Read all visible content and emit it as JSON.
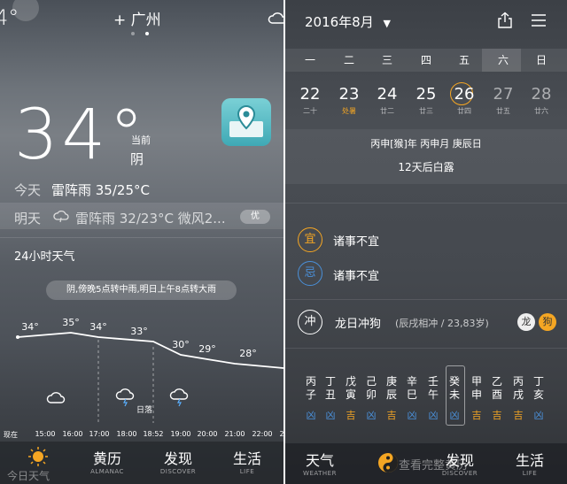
{
  "left": {
    "edge_temp": "4°",
    "city": "+ 广州",
    "current": {
      "temp": "34°",
      "label": "当前",
      "condition": "阴"
    },
    "today": {
      "label": "今天",
      "text": "雷阵雨 35/25°C"
    },
    "tomorrow": {
      "label": "明天",
      "text": "雷阵雨 32/23°C 微风2...",
      "badge": "优"
    },
    "hourly_title": "24小时天气",
    "notice": "阴,傍晚5点转中雨,明日上午8点转大雨",
    "hourly": {
      "temps": [
        "34°",
        "35°",
        "34°",
        "33°",
        "30°",
        "29°",
        "28°"
      ],
      "temp_values": [
        34,
        35,
        34,
        33,
        30,
        29,
        28
      ],
      "sunset_label": "日落",
      "times": [
        "现在",
        "15:00",
        "16:00",
        "17:00",
        "18:00",
        "18:52",
        "19:00",
        "20:00",
        "21:00",
        "22:00",
        "2"
      ]
    },
    "tabs": [
      {
        "label": "今日天气",
        "sub": ""
      },
      {
        "label": "黄历",
        "sub": "ALMANAC"
      },
      {
        "label": "发现",
        "sub": "DISCOVER"
      },
      {
        "label": "生活",
        "sub": "LIFE"
      }
    ]
  },
  "right": {
    "month": "2016年8月",
    "weekdays": [
      "一",
      "二",
      "三",
      "四",
      "五",
      "六",
      "日"
    ],
    "days": [
      {
        "num": "22",
        "sub": "二十"
      },
      {
        "num": "23",
        "sub": "处暑"
      },
      {
        "num": "24",
        "sub": "廿二"
      },
      {
        "num": "25",
        "sub": "廿三"
      },
      {
        "num": "26",
        "sub": "廿四"
      },
      {
        "num": "27",
        "sub": "廿五"
      },
      {
        "num": "28",
        "sub": "廿六"
      }
    ],
    "ganzhi": "丙申[猴]年 丙申月 庚辰日",
    "solar_term": "12天后白露",
    "yi": {
      "icon": "宜",
      "text": "诸事不宜"
    },
    "ji": {
      "icon": "忌",
      "text": "诸事不宜"
    },
    "chong": {
      "icon": "冲",
      "text": "龙日冲狗",
      "detail": "(辰戌相冲 / 23,83岁)",
      "badge1": "龙",
      "badge2": "狗"
    },
    "hours": [
      {
        "top": "丙",
        "bot": "子",
        "luck": "凶"
      },
      {
        "top": "丁",
        "bot": "丑",
        "luck": "凶"
      },
      {
        "top": "戊",
        "bot": "寅",
        "luck": "吉"
      },
      {
        "top": "己",
        "bot": "卯",
        "luck": "凶"
      },
      {
        "top": "庚",
        "bot": "辰",
        "luck": "吉"
      },
      {
        "top": "辛",
        "bot": "巳",
        "luck": "凶"
      },
      {
        "top": "壬",
        "bot": "午",
        "luck": "凶"
      },
      {
        "top": "癸",
        "bot": "未",
        "luck": "凶"
      },
      {
        "top": "甲",
        "bot": "申",
        "luck": "吉"
      },
      {
        "top": "乙",
        "bot": "酉",
        "luck": "吉"
      },
      {
        "top": "丙",
        "bot": "戌",
        "luck": "吉"
      },
      {
        "top": "丁",
        "bot": "亥",
        "luck": "凶"
      }
    ],
    "tabs": [
      {
        "label": "天气",
        "sub": "WEATHER"
      },
      {
        "label": "查看完整黄历",
        "sub": ""
      },
      {
        "label": "发现",
        "sub": "DISCOVER"
      },
      {
        "label": "生活",
        "sub": "LIFE"
      }
    ]
  },
  "colors": {
    "accent": "#f5a623",
    "ji_blue": "#4a90d9",
    "xiong": "#4a90d9",
    "ji": "#f5a623"
  }
}
